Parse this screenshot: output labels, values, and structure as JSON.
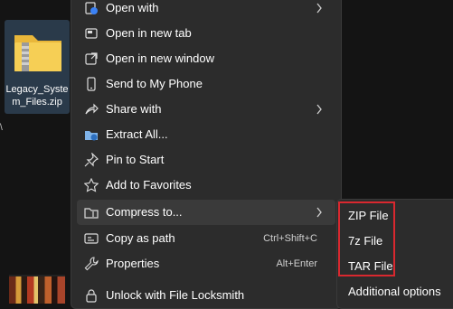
{
  "desktop": {
    "file_name": "Legacy_System_Files.zip"
  },
  "context_menu": {
    "items": [
      {
        "label": "Open with",
        "icon": "open-with-icon",
        "submenu": true
      },
      {
        "label": "Open in new tab",
        "icon": "new-tab-icon"
      },
      {
        "label": "Open in new window",
        "icon": "new-window-icon"
      },
      {
        "label": "Send to My Phone",
        "icon": "phone-icon"
      },
      {
        "label": "Share with",
        "icon": "share-icon",
        "submenu": true
      },
      {
        "label": "Extract All...",
        "icon": "extract-icon"
      },
      {
        "label": "Pin to Start",
        "icon": "pin-icon"
      },
      {
        "label": "Add to Favorites",
        "icon": "star-icon"
      },
      {
        "label": "Compress to...",
        "icon": "compress-icon",
        "submenu": true
      },
      {
        "label": "Copy as path",
        "icon": "copy-path-icon",
        "shortcut": "Ctrl+Shift+C"
      },
      {
        "label": "Properties",
        "icon": "wrench-icon",
        "shortcut": "Alt+Enter"
      },
      {
        "label": "Unlock with File Locksmith",
        "icon": "lock-icon"
      }
    ]
  },
  "submenu": {
    "items": [
      "ZIP File",
      "7z File",
      "TAR File",
      "Additional options"
    ]
  },
  "colors": {
    "menu_bg": "#2c2c2c",
    "hover_bg": "#3a3a3a",
    "highlight": "#d9282f",
    "folder": "#f2c84b"
  }
}
